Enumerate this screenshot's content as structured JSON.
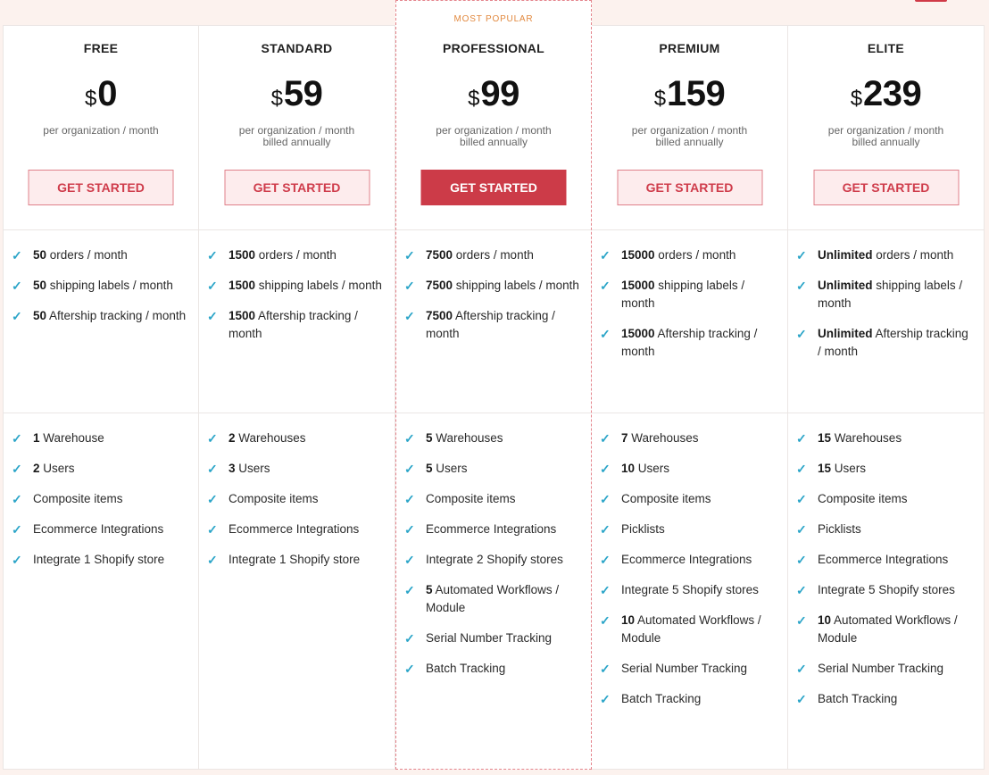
{
  "colors": {
    "accent": "#cc3b48",
    "check": "#2ba5c8",
    "badge": "#e2893f",
    "background": "#fcf2ee"
  },
  "check_icon": "✓",
  "plans": [
    {
      "name": "FREE",
      "currency": "$",
      "amount": "0",
      "billing_line1": "per organization / month",
      "billing_line2": "",
      "cta": "GET STARTED",
      "featured": false,
      "limits": [
        {
          "num": "50",
          "text": " orders / month"
        },
        {
          "num": "50",
          "text": " shipping labels / month"
        },
        {
          "num": "50",
          "text": " Aftership tracking / month"
        }
      ],
      "features": [
        {
          "num": "1",
          "text": " Warehouse"
        },
        {
          "num": "2",
          "text": " Users"
        },
        {
          "num": "",
          "text": "Composite items"
        },
        {
          "num": "",
          "text": "Ecommerce Integrations"
        },
        {
          "num": "",
          "text": "Integrate 1 Shopify store"
        }
      ]
    },
    {
      "name": "STANDARD",
      "currency": "$",
      "amount": "59",
      "billing_line1": "per organization / month",
      "billing_line2": "billed annually",
      "cta": "GET STARTED",
      "featured": false,
      "limits": [
        {
          "num": "1500",
          "text": " orders / month"
        },
        {
          "num": "1500",
          "text": " shipping labels / month"
        },
        {
          "num": "1500",
          "text": " Aftership tracking / month"
        }
      ],
      "features": [
        {
          "num": "2",
          "text": " Warehouses"
        },
        {
          "num": "3",
          "text": " Users"
        },
        {
          "num": "",
          "text": "Composite items"
        },
        {
          "num": "",
          "text": "Ecommerce Integrations"
        },
        {
          "num": "",
          "text": "Integrate 1 Shopify store"
        }
      ]
    },
    {
      "name": "PROFESSIONAL",
      "badge": "MOST POPULAR",
      "currency": "$",
      "amount": "99",
      "billing_line1": "per organization / month",
      "billing_line2": "billed annually",
      "cta": "GET STARTED",
      "featured": true,
      "limits": [
        {
          "num": "7500",
          "text": " orders / month"
        },
        {
          "num": "7500",
          "text": " shipping labels / month"
        },
        {
          "num": "7500",
          "text": " Aftership tracking / month"
        }
      ],
      "features": [
        {
          "num": "5",
          "text": " Warehouses"
        },
        {
          "num": "5",
          "text": " Users"
        },
        {
          "num": "",
          "text": "Composite items"
        },
        {
          "num": "",
          "text": "Ecommerce Integrations"
        },
        {
          "num": "",
          "text": "Integrate 2 Shopify stores"
        },
        {
          "num": "5",
          "text": " Automated Workflows / Module"
        },
        {
          "num": "",
          "text": "Serial Number Tracking"
        },
        {
          "num": "",
          "text": "Batch Tracking"
        }
      ]
    },
    {
      "name": "PREMIUM",
      "currency": "$",
      "amount": "159",
      "billing_line1": "per organization / month",
      "billing_line2": "billed annually",
      "cta": "GET STARTED",
      "featured": false,
      "limits": [
        {
          "num": "15000",
          "text": " orders / month"
        },
        {
          "num": "15000",
          "text": " shipping labels / month"
        },
        {
          "num": "15000",
          "text": " Aftership tracking / month"
        }
      ],
      "features": [
        {
          "num": "7",
          "text": " Warehouses"
        },
        {
          "num": "10",
          "text": " Users"
        },
        {
          "num": "",
          "text": "Composite items"
        },
        {
          "num": "",
          "text": "Picklists"
        },
        {
          "num": "",
          "text": "Ecommerce Integrations"
        },
        {
          "num": "",
          "text": "Integrate 5 Shopify stores"
        },
        {
          "num": "10",
          "text": " Automated Workflows / Module"
        },
        {
          "num": "",
          "text": "Serial Number Tracking"
        },
        {
          "num": "",
          "text": "Batch Tracking"
        }
      ]
    },
    {
      "name": "ELITE",
      "currency": "$",
      "amount": "239",
      "billing_line1": "per organization / month",
      "billing_line2": "billed annually",
      "cta": "GET STARTED",
      "featured": false,
      "limits": [
        {
          "num": "Unlimited",
          "text": " orders / month"
        },
        {
          "num": "Unlimited",
          "text": " shipping labels / month"
        },
        {
          "num": "Unlimited",
          "text": " Aftership tracking / month"
        }
      ],
      "features": [
        {
          "num": "15",
          "text": " Warehouses"
        },
        {
          "num": "15",
          "text": " Users"
        },
        {
          "num": "",
          "text": "Composite items"
        },
        {
          "num": "",
          "text": "Picklists"
        },
        {
          "num": "",
          "text": "Ecommerce Integrations"
        },
        {
          "num": "",
          "text": "Integrate 5 Shopify stores"
        },
        {
          "num": "10",
          "text": " Automated Workflows / Module"
        },
        {
          "num": "",
          "text": "Serial Number Tracking"
        },
        {
          "num": "",
          "text": "Batch Tracking"
        }
      ]
    }
  ]
}
